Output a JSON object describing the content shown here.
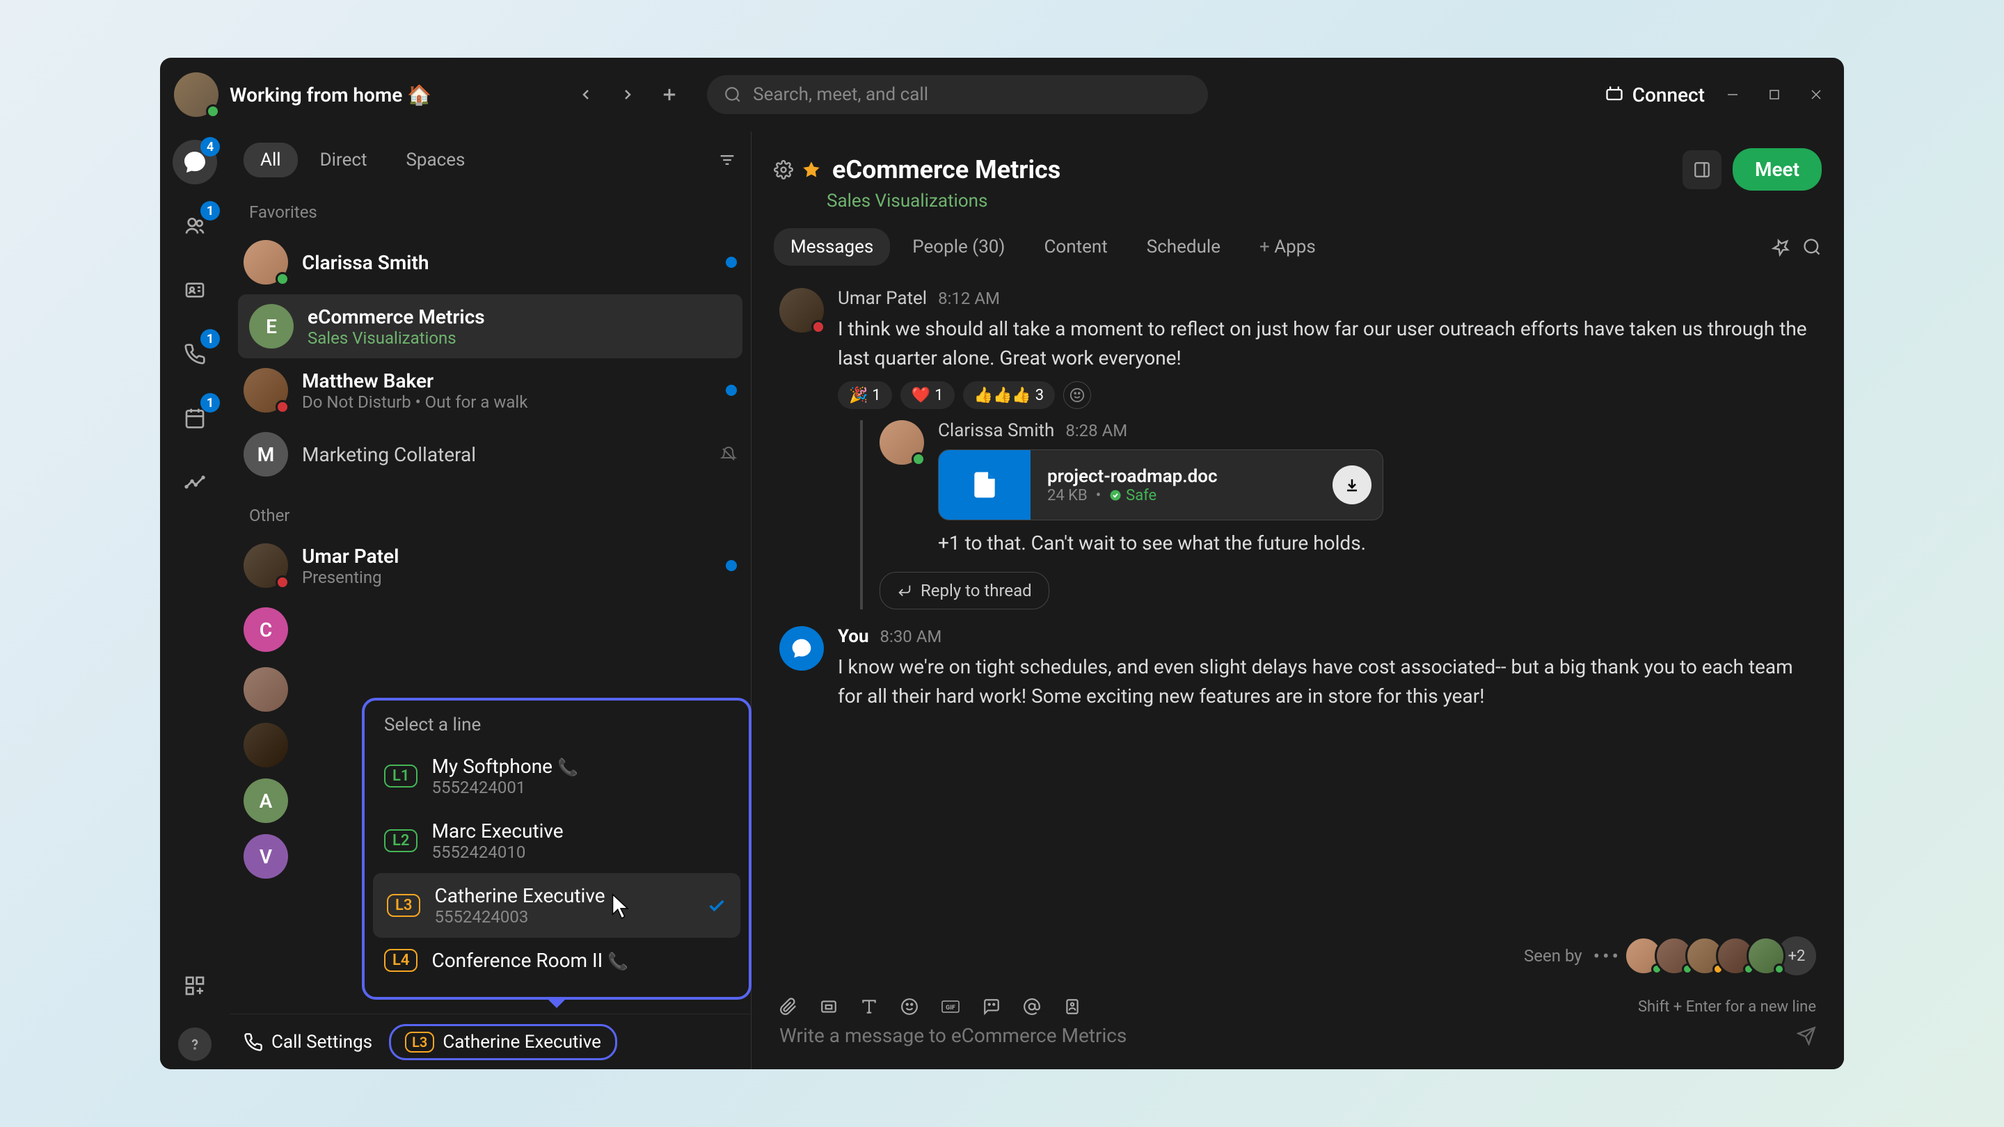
{
  "titlebar": {
    "status": "Working from home 🏠",
    "search_placeholder": "Search, meet, and call",
    "connect": "Connect"
  },
  "rail": {
    "messages_badge": "4",
    "teams_badge": "1",
    "calls_badge": "1",
    "calendar_badge": "1"
  },
  "sidebar": {
    "tabs": {
      "all": "All",
      "direct": "Direct",
      "spaces": "Spaces"
    },
    "favorites_label": "Favorites",
    "other_label": "Other",
    "favorites": [
      {
        "name": "Clarissa Smith",
        "sub": "",
        "unread": true
      },
      {
        "name": "eCommerce Metrics",
        "sub": "Sales Visualizations",
        "letter": "E",
        "selected": true,
        "sub_green": true
      },
      {
        "name": "Matthew Baker",
        "sub": "Do Not Disturb  •  Out for a walk",
        "unread": true,
        "dnd": true
      },
      {
        "name": "Marketing Collateral",
        "letter": "M",
        "muted": true
      }
    ],
    "other": [
      {
        "name": "Umar Patel",
        "sub": "Presenting",
        "unread": true,
        "dnd": true
      },
      {
        "letter": "C"
      },
      {
        "letter": ""
      },
      {
        "letter": ""
      },
      {
        "letter": "A",
        "green": true
      },
      {
        "letter": "V",
        "purple": true
      }
    ]
  },
  "linePopup": {
    "title": "Select a line",
    "lines": [
      {
        "badge": "L1",
        "badge_color": "green",
        "name": "My Softphone",
        "number": "5552424001",
        "phone": true
      },
      {
        "badge": "L2",
        "badge_color": "green",
        "name": "Marc Executive",
        "number": "5552424010"
      },
      {
        "badge": "L3",
        "badge_color": "orange",
        "name": "Catherine Executive",
        "number": "5552424003",
        "selected": true,
        "checked": true
      },
      {
        "badge": "L4",
        "badge_color": "orange",
        "name": "Conference Room II",
        "phone": true
      }
    ]
  },
  "bottomBar": {
    "call_settings": "Call Settings",
    "selected_badge": "L3",
    "selected_name": "Catherine Executive"
  },
  "content": {
    "title": "eCommerce Metrics",
    "subtitle": "Sales Visualizations",
    "meet": "Meet",
    "tabs": {
      "messages": "Messages",
      "people": "People (30)",
      "content": "Content",
      "schedule": "Schedule",
      "apps": "Apps"
    }
  },
  "messages": [
    {
      "author": "Umar Patel",
      "time": "8:12 AM",
      "text": "I think we should all take a moment to reflect on just how far our user outreach efforts have taken us through the last quarter alone. Great work everyone!",
      "reactions": [
        {
          "emoji": "🎉",
          "count": "1"
        },
        {
          "emoji": "❤️",
          "count": "1"
        },
        {
          "emoji": "👍👍👍",
          "count": "3"
        }
      ],
      "thread": {
        "author": "Clarissa Smith",
        "time": "8:28 AM",
        "file": {
          "name": "project-roadmap.doc",
          "size": "24 KB",
          "safe": "Safe"
        },
        "text": "+1 to that. Can't wait to see what the future holds.",
        "reply_btn": "Reply to thread"
      }
    },
    {
      "author": "You",
      "time": "8:30 AM",
      "self": true,
      "text": "I know we're on tight schedules, and even slight delays have cost associated-- but a big thank you to each team for all their hard work! Some exciting new features are in store for this year!"
    }
  ],
  "seenBy": {
    "label": "Seen by",
    "more": "+2"
  },
  "composer": {
    "hint": "Shift + Enter for a new line",
    "placeholder": "Write a message to eCommerce Metrics"
  }
}
